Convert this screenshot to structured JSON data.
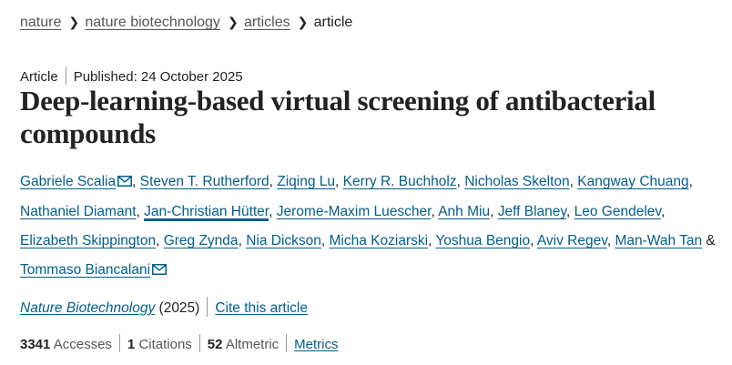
{
  "breadcrumb": {
    "items": [
      "nature",
      "nature biotechnology",
      "articles"
    ],
    "current": "article",
    "separator": "›"
  },
  "meta": {
    "type": "Article",
    "published": "Published: 24 October 2025"
  },
  "title": "Deep-learning-based virtual screening of antibacterial compounds",
  "authors": [
    {
      "name": "Gabriele Scalia",
      "email_icon": true
    },
    {
      "name": "Steven T. Rutherford"
    },
    {
      "name": "Ziqing Lu"
    },
    {
      "name": "Kerry R. Buchholz"
    },
    {
      "name": "Nicholas Skelton"
    },
    {
      "name": "Kangway Chuang"
    },
    {
      "name": "Nathaniel Diamant"
    },
    {
      "name": "Jan-Christian Hütter",
      "hovered": true
    },
    {
      "name": "Jerome-Maxim Luescher"
    },
    {
      "name": "Anh Miu"
    },
    {
      "name": "Jeff Blaney"
    },
    {
      "name": "Leo Gendelev"
    },
    {
      "name": "Elizabeth Skippington"
    },
    {
      "name": "Greg Zynda"
    },
    {
      "name": "Nia Dickson"
    },
    {
      "name": "Micha Koziarski"
    },
    {
      "name": "Yoshua Bengio"
    },
    {
      "name": "Aviv Regev"
    },
    {
      "name": "Man-Wah Tan"
    },
    {
      "name": "Tommaso Biancalani",
      "email_icon": true
    }
  ],
  "author_sep": ", ",
  "author_last_sep": " & ",
  "journal": {
    "name": "Nature Biotechnology",
    "year": "(2025)",
    "cite_label": "Cite this article"
  },
  "metrics": {
    "accesses_value": "3341",
    "accesses_label": "Accesses",
    "citations_value": "1",
    "citations_label": "Citations",
    "altmetric_value": "52",
    "altmetric_label": "Altmetric",
    "metrics_link": "Metrics"
  },
  "colors": {
    "link": "#025e8d",
    "text": "#222222",
    "muted": "#555555"
  },
  "icons": {
    "breadcrumb_separator": "chevron-right-icon",
    "author_contact": "envelope-icon"
  }
}
